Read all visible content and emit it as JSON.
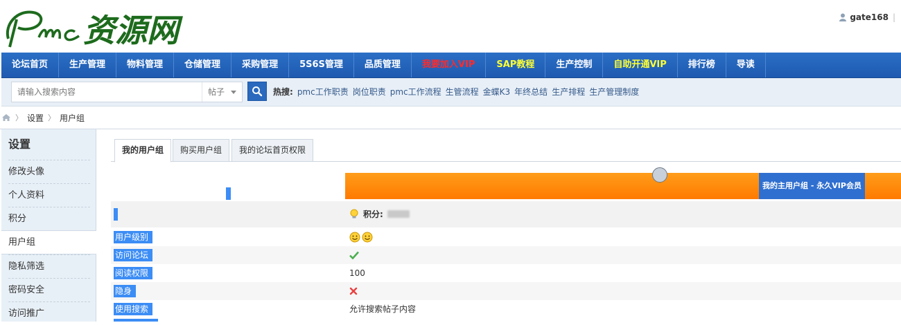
{
  "header": {
    "logo_text": "Pmc资源网",
    "username": "gate168",
    "user_separator": "|"
  },
  "nav": {
    "items": [
      {
        "label": "论坛首页",
        "color": "#ffffff"
      },
      {
        "label": "生产管理",
        "color": "#ffffff"
      },
      {
        "label": "物料管理",
        "color": "#ffffff"
      },
      {
        "label": "仓储管理",
        "color": "#ffffff"
      },
      {
        "label": "采购管理",
        "color": "#ffffff"
      },
      {
        "label": "5S6S管理",
        "color": "#ffffff"
      },
      {
        "label": "品质管理",
        "color": "#ffffff"
      },
      {
        "label": "我要加入VIP",
        "color": "#ff2a2a"
      },
      {
        "label": "SAP教程",
        "color": "#ffff33"
      },
      {
        "label": "生产控制",
        "color": "#ffffff"
      },
      {
        "label": "自助开通VIP",
        "color": "#ffff33"
      },
      {
        "label": "排行榜",
        "color": "#ffffff"
      },
      {
        "label": "导读",
        "color": "#ffffff"
      }
    ]
  },
  "search": {
    "placeholder": "请输入搜索内容",
    "type_selected": "帖子",
    "hot_label": "热搜:",
    "hot_links": [
      "pmc工作职责",
      "岗位职责",
      "pmc工作流程",
      "生管流程",
      "金蝶K3",
      "年终总结",
      "生产排程",
      "生产管理制度"
    ]
  },
  "breadcrumb": {
    "items": [
      "设置",
      "用户组"
    ]
  },
  "sidebar": {
    "title": "设置",
    "items": [
      {
        "label": "修改头像"
      },
      {
        "label": "个人资料"
      },
      {
        "label": "积分"
      },
      {
        "label": "用户组"
      },
      {
        "label": "隐私筛选"
      },
      {
        "label": "密码安全"
      },
      {
        "label": "访问推广"
      }
    ],
    "active_index": 3
  },
  "tabs": [
    {
      "label": "我的用户组"
    },
    {
      "label": "购买用户组"
    },
    {
      "label": "我的论坛首页权限"
    }
  ],
  "group": {
    "title": "我的主用户组 - 永久VIP会员",
    "credits_label": "积分:"
  },
  "permissions": [
    {
      "label": "用户级别",
      "value": "",
      "icon": "smiley-icon-x2"
    },
    {
      "label": "访问论坛",
      "value": "",
      "icon": "check-icon"
    },
    {
      "label": "阅读权限",
      "value": "100",
      "icon": ""
    },
    {
      "label": "隐身",
      "value": "",
      "icon": "cross-icon"
    },
    {
      "label": "使用搜索",
      "value": "允许搜索帖子内容",
      "icon": ""
    }
  ],
  "colors": {
    "nav_bg": "#1e5ab0",
    "accent_orange": "#ff8a00",
    "label_blue": "#3c8df5",
    "check_green": "#4caf50",
    "cross_red": "#e94040"
  }
}
